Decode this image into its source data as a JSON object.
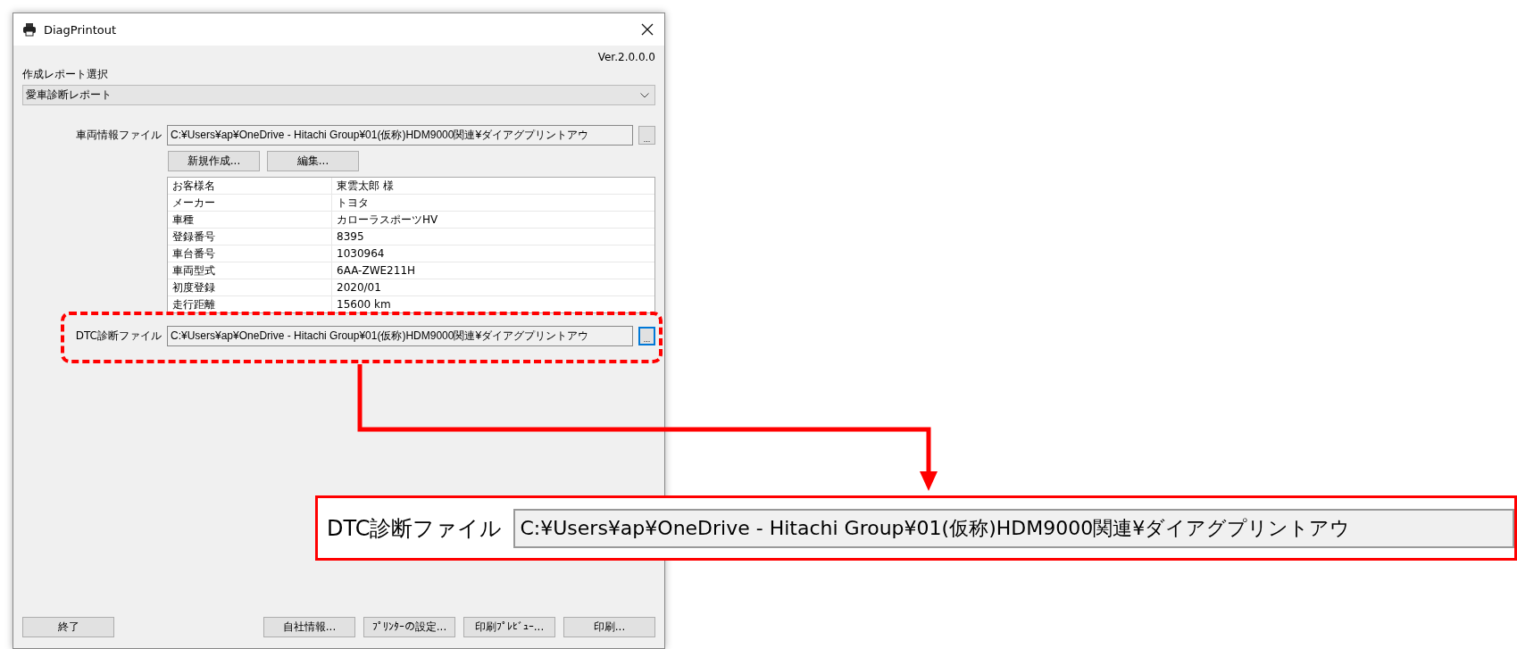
{
  "window": {
    "title": "DiagPrintout",
    "version": "Ver.2.0.0.0"
  },
  "report": {
    "label": "作成レポート選択",
    "value": "愛車診断レポート"
  },
  "vehicle_file": {
    "label": "車両情報ファイル",
    "value": "C:¥Users¥ap¥OneDrive - Hitachi Group¥01(仮称)HDM9000関連¥ダイアグプリントアウ",
    "browse": "...",
    "focused": false
  },
  "vehicle_buttons": [
    "新規作成...",
    "編集..."
  ],
  "vehicle_info": [
    {
      "item": "お客様名",
      "value": "東雲太郎 様"
    },
    {
      "item": "メーカー",
      "value": "トヨタ"
    },
    {
      "item": "車種",
      "value": "カローラスポーツHV"
    },
    {
      "item": "登録番号",
      "value": "8395"
    },
    {
      "item": "車台番号",
      "value": "1030964"
    },
    {
      "item": "車両型式",
      "value": "6AA-ZWE211H"
    },
    {
      "item": "初度登録",
      "value": "2020/01"
    },
    {
      "item": "走行距離",
      "value": "15600 km"
    }
  ],
  "dtc_file": {
    "label": "DTC診断ファイル",
    "value": "C:¥Users¥ap¥OneDrive - Hitachi Group¥01(仮称)HDM9000関連¥ダイアグプリントアウ",
    "browse": "...",
    "focused": true
  },
  "footer_buttons": [
    "終了",
    "自社情報...",
    "ﾌﾟﾘﾝﾀｰの設定...",
    "印刷ﾌﾟﾚﾋﾞｭｰ...",
    "印刷..."
  ],
  "callout": {
    "label": "DTC診断ファイル",
    "value": "C:¥Users¥ap¥OneDrive - Hitachi Group¥01(仮称)HDM9000関連¥ダイアグプリントアウ"
  }
}
